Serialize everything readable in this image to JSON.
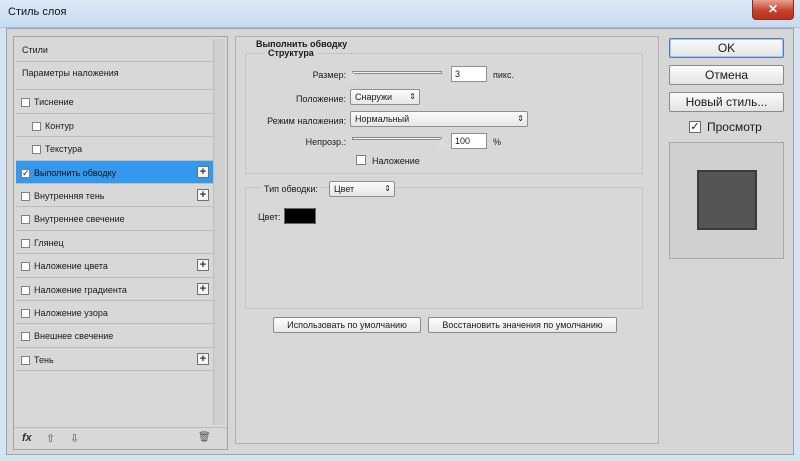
{
  "window": {
    "title": "Стиль слоя",
    "close_glyph": "✕"
  },
  "left_panel": {
    "items": [
      {
        "label": "Стили",
        "checkbox": false,
        "checked": false,
        "plus": false,
        "indent": false
      },
      {
        "label": "Параметры наложения",
        "checkbox": false,
        "checked": false,
        "plus": false,
        "indent": false
      },
      {
        "label": "Тиснение",
        "checkbox": true,
        "checked": false,
        "plus": false,
        "indent": false
      },
      {
        "label": "Контур",
        "checkbox": true,
        "checked": false,
        "plus": false,
        "indent": true
      },
      {
        "label": "Текстура",
        "checkbox": true,
        "checked": false,
        "plus": false,
        "indent": true
      },
      {
        "label": "Выполнить обводку",
        "checkbox": true,
        "checked": true,
        "plus": true,
        "indent": false,
        "selected": true
      },
      {
        "label": "Внутренняя тень",
        "checkbox": true,
        "checked": false,
        "plus": true,
        "indent": false
      },
      {
        "label": "Внутреннее свечение",
        "checkbox": true,
        "checked": false,
        "plus": false,
        "indent": false
      },
      {
        "label": "Глянец",
        "checkbox": true,
        "checked": false,
        "plus": false,
        "indent": false
      },
      {
        "label": "Наложение цвета",
        "checkbox": true,
        "checked": false,
        "plus": true,
        "indent": false
      },
      {
        "label": "Наложение градиента",
        "checkbox": true,
        "checked": false,
        "plus": true,
        "indent": false
      },
      {
        "label": "Наложение узора",
        "checkbox": true,
        "checked": false,
        "plus": false,
        "indent": false
      },
      {
        "label": "Внешнее свечение",
        "checkbox": true,
        "checked": false,
        "plus": false,
        "indent": false
      },
      {
        "label": "Тень",
        "checkbox": true,
        "checked": false,
        "plus": true,
        "indent": false
      }
    ],
    "footer": {
      "fx": "fx",
      "up": "⇧",
      "down": "⇩",
      "trash": "🗑"
    }
  },
  "stroke": {
    "section_title": "Выполнить обводку",
    "structure": {
      "title": "Структура",
      "size_label": "Размер:",
      "size_value": "3",
      "size_unit": "пикс.",
      "size_slider_fraction": 0.01,
      "position_label": "Положение:",
      "position_value": "Снаружи",
      "blend_label": "Режим наложения:",
      "blend_value": "Нормальный",
      "opacity_label": "Непрозр.:",
      "opacity_value": "100",
      "opacity_unit": "%",
      "opacity_slider_fraction": 1.0,
      "overprint_label": "Наложение",
      "overprint_checked": false
    },
    "fill": {
      "type_label": "Тип обводки:",
      "type_value": "Цвет",
      "color_label": "Цвет:",
      "color_value": "#000000"
    },
    "buttons": {
      "make_default": "Использовать по умолчанию",
      "reset_default": "Восстановить значения по умолчанию"
    }
  },
  "right": {
    "ok": "OK",
    "cancel": "Отмена",
    "new_style": "Новый стиль...",
    "preview_label": "Просмотр",
    "preview_checked": true,
    "preview_color": "#555558"
  }
}
